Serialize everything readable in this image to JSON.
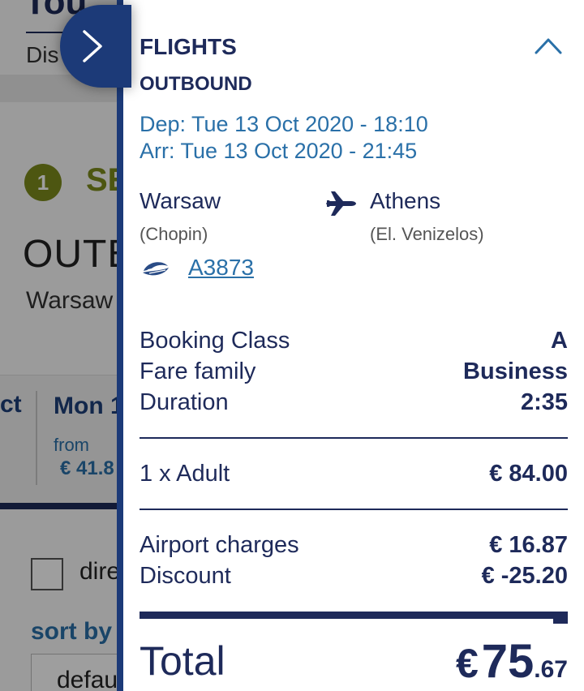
{
  "background": {
    "title": "Tou",
    "subtitle": "Dis",
    "step_number": "1",
    "step_label": "SE",
    "outbound_heading": "OUTB",
    "city": "Warsaw",
    "date_prev_label": "ct",
    "date_day": "Mon 1",
    "date_from_label": "from",
    "date_price": "€ 41.8",
    "checkbox_label": "dire",
    "sort_label": "sort by",
    "sort_value": "defau"
  },
  "panel": {
    "title": "FLIGHTS",
    "subtitle": "OUTBOUND",
    "departure": "Dep: Tue 13 Oct 2020 - 18:10",
    "arrival": "Arr: Tue 13 Oct 2020 - 21:45",
    "origin_city": "Warsaw",
    "origin_airport": "(Chopin)",
    "destination_city": "Athens",
    "destination_airport": "(El. Venizelos)",
    "flight_number": "A3873",
    "booking_class_label": "Booking Class",
    "booking_class_value": "A",
    "fare_family_label": "Fare family",
    "fare_family_value": "Business",
    "duration_label": "Duration",
    "duration_value": "2:35",
    "passenger_label": "1 x Adult",
    "passenger_price": "€ 84.00",
    "airport_charges_label": "Airport charges",
    "airport_charges_value": "€ 16.87",
    "discount_label": "Discount",
    "discount_value": "€ -25.20",
    "total_label": "Total",
    "total_currency": "€",
    "total_integer": "75",
    "total_decimal": ".67"
  },
  "icons": {
    "collapse": "chevron-right-icon",
    "section_toggle": "chevron-up-icon",
    "route": "airplane-icon",
    "airline": "airline-logo-icon"
  },
  "colors": {
    "navy": "#1e2a5a",
    "accent_blue": "#2a70a8",
    "panel_border": "#1c3a78",
    "step_green": "#7c8b1c"
  }
}
